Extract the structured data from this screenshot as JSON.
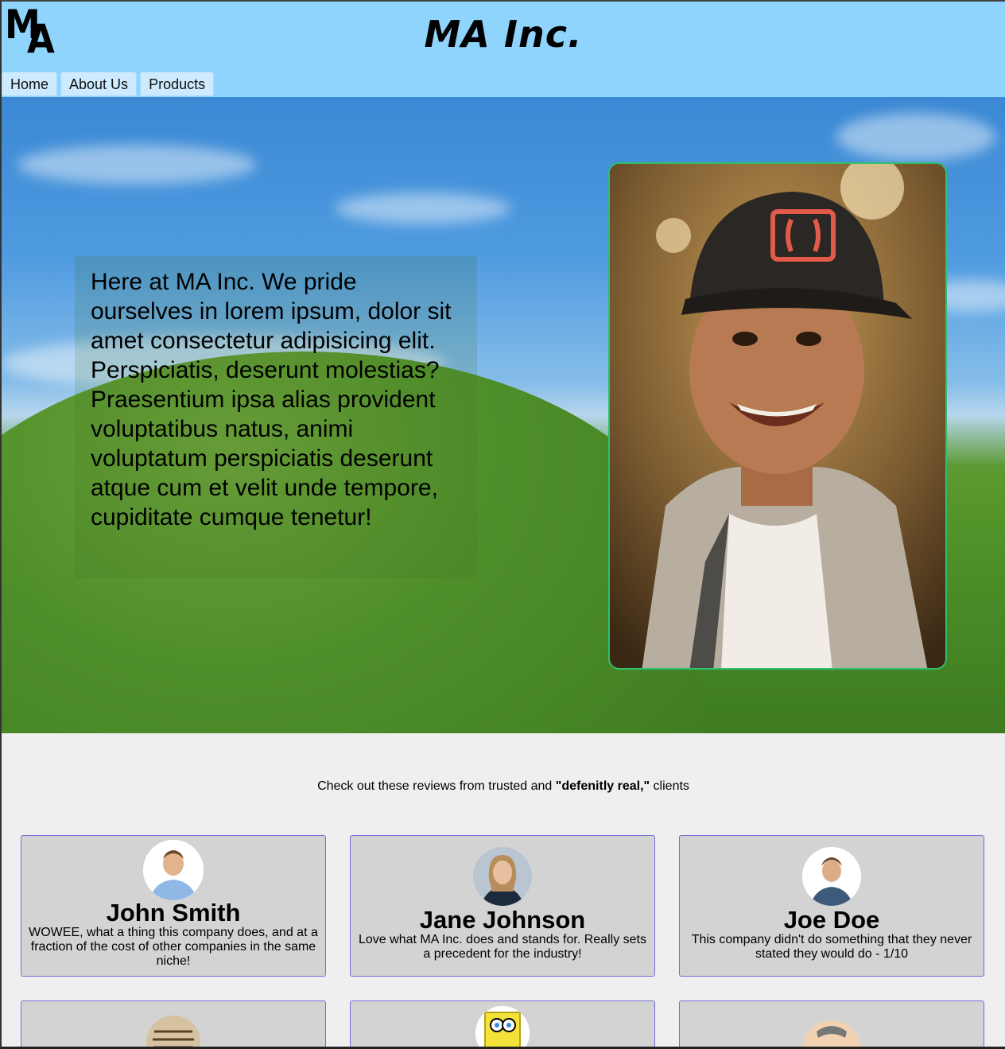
{
  "header": {
    "logo_m": "M",
    "logo_a": "A",
    "title": "MA Inc."
  },
  "nav": {
    "items": [
      "Home",
      "About Us",
      "Products"
    ]
  },
  "hero": {
    "text": "Here at MA Inc. We pride ourselves in lorem ipsum, dolor sit amet consectetur adipisicing elit. Perspiciatis, deserunt molestias? Praesentium ipsa alias provident voluptatibus natus, animi voluptatum perspiciatis deserunt atque cum et velit unde tempore, cupiditate cumque tenetur!"
  },
  "reviews": {
    "intro_prefix": "Check out these reviews from trusted and ",
    "intro_bold": "\"defenitly real,\"",
    "intro_suffix": " clients",
    "cards": [
      {
        "name": "John Smith",
        "text": "WOWEE, what a thing this company does, and at a fraction of the cost of other companies in the same niche!"
      },
      {
        "name": "Jane Johnson",
        "text": "Love what MA Inc. does and stands for. Really sets a precedent for the industry!"
      },
      {
        "name": "Joe Doe",
        "text": "This company didn't do something that they never stated they would do - 1/10"
      }
    ]
  },
  "colors": {
    "header_bg": "#8ed4fd",
    "card_bg": "#d3d3d3",
    "card_border": "#7070d8",
    "portrait_border": "#2fbf6f"
  }
}
